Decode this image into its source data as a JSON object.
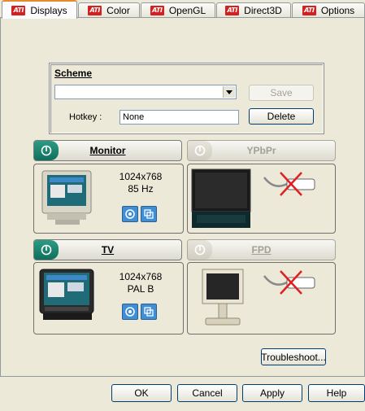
{
  "tabs": [
    {
      "label": "Displays",
      "icon": "ati-logo",
      "active": true
    },
    {
      "label": "Color",
      "icon": "ati-logo",
      "active": false
    },
    {
      "label": "OpenGL",
      "icon": "ati-logo",
      "active": false
    },
    {
      "label": "Direct3D",
      "icon": "ati-logo",
      "active": false
    },
    {
      "label": "Options",
      "icon": "ati-logo",
      "active": false
    }
  ],
  "ati_logo_text": "ATI",
  "scheme": {
    "title": "Scheme",
    "value": "",
    "save_label": "Save",
    "delete_label": "Delete",
    "hotkey_label": "Hotkey :",
    "hotkey_value": "None"
  },
  "devices": {
    "monitor": {
      "label": "Monitor",
      "enabled": true,
      "resolution": "1024x768",
      "detail": "85 Hz"
    },
    "ypbpr": {
      "label": "YPbPr",
      "enabled": false
    },
    "tv": {
      "label": "TV",
      "enabled": true,
      "resolution": "1024x768",
      "detail": "PAL B"
    },
    "fpd": {
      "label": "FPD",
      "enabled": false
    }
  },
  "troubleshoot_label": "Troubleshoot...",
  "dialog_buttons": {
    "ok": "OK",
    "cancel": "Cancel",
    "apply": "Apply",
    "help": "Help"
  },
  "colors": {
    "ati_red": "#d6201f",
    "device_on": "#1a7f6b",
    "tab_highlight": "#e68b2c",
    "button_border": "#003c74"
  }
}
